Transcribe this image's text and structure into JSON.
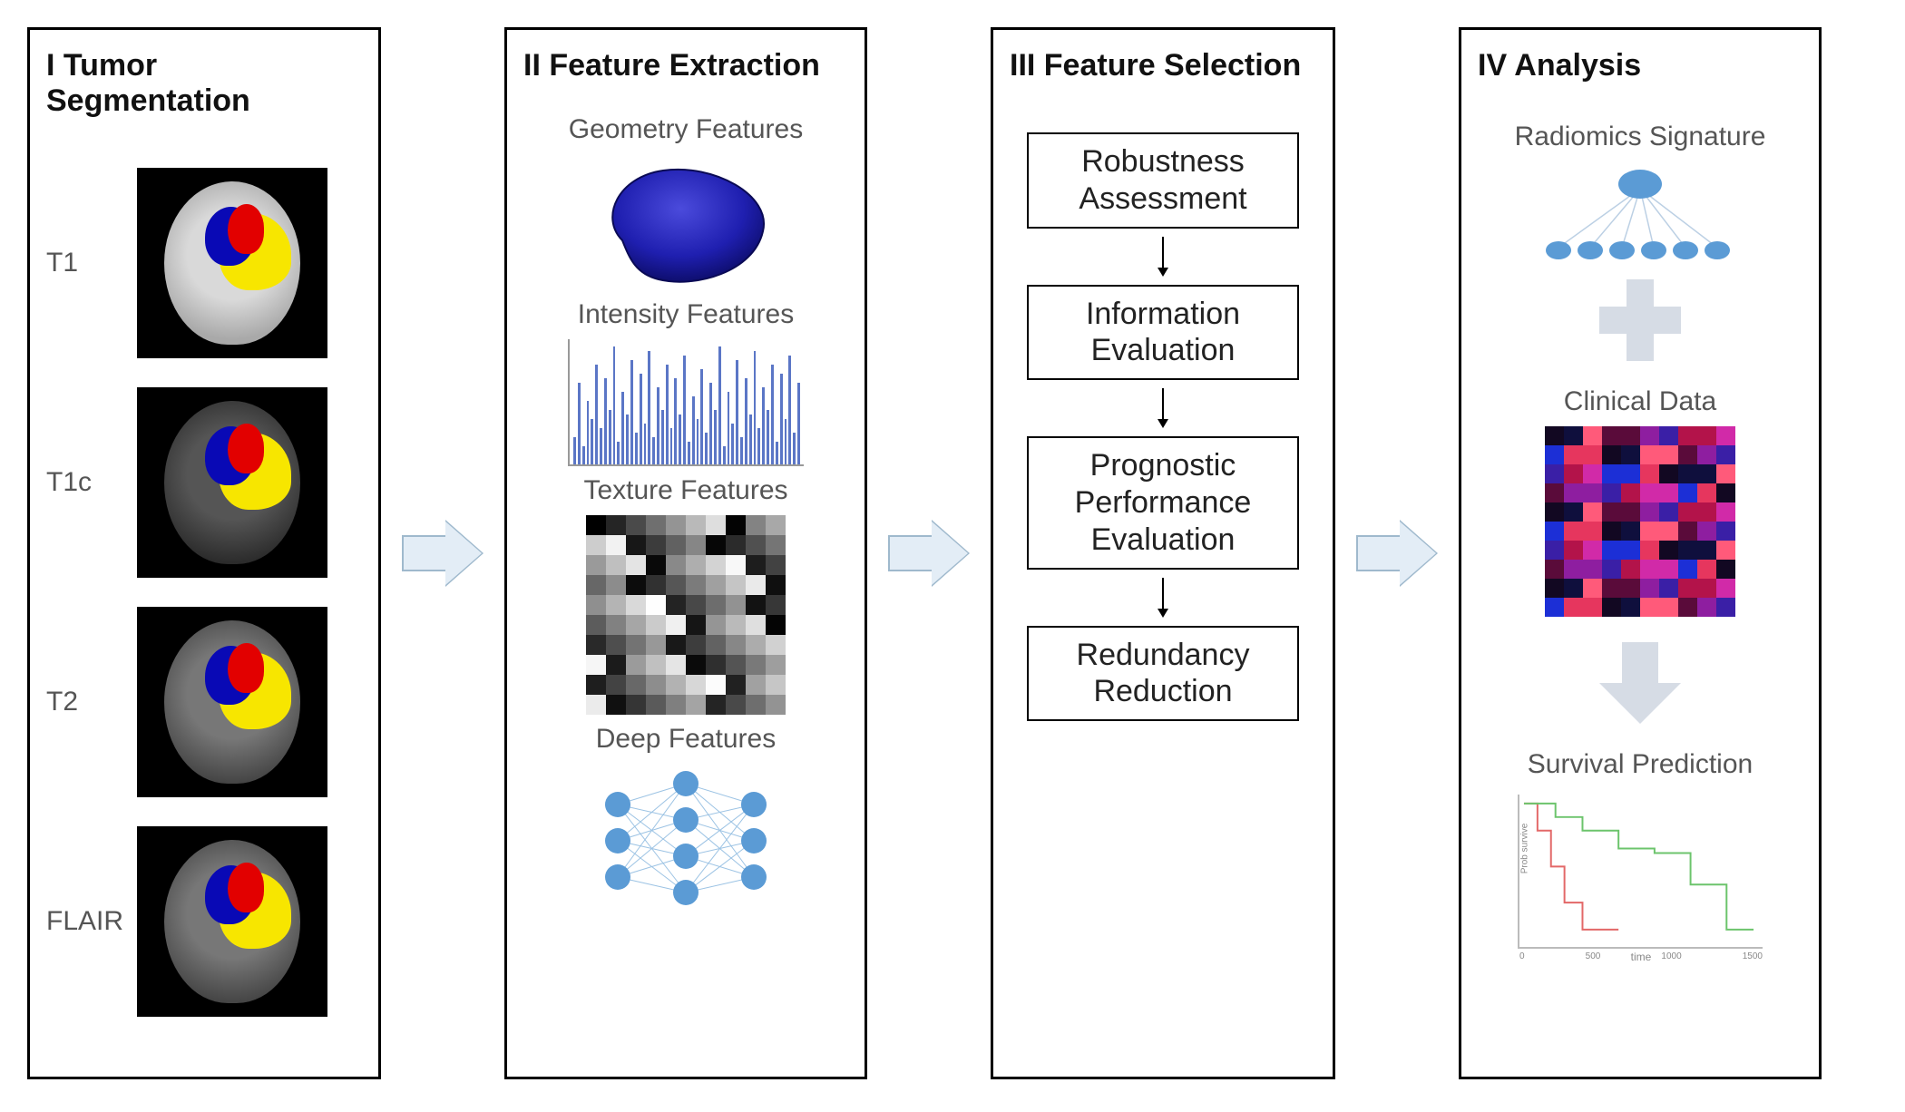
{
  "panel1": {
    "title": "I  Tumor Segmentation",
    "scans": [
      "T1",
      "T1c",
      "T2",
      "FLAIR"
    ]
  },
  "panel2": {
    "title": "II  Feature Extraction",
    "geometry": "Geometry Features",
    "intensity": "Intensity Features",
    "texture": "Texture Features",
    "deep": "Deep Features"
  },
  "panel3": {
    "title": "III Feature Selection",
    "steps": [
      "Robustness Assessment",
      "Information Evaluation",
      "Prognostic Performance Evaluation",
      "Redundancy Reduction"
    ]
  },
  "panel4": {
    "title": "IV  Analysis",
    "sig": "Radiomics Signature",
    "clin": "Clinical Data",
    "surv": "Survival Prediction",
    "surv_xlabel": "time",
    "surv_ylabel": "Prob survive",
    "surv_ticks": [
      "0",
      "500",
      "1000",
      "1500"
    ]
  },
  "colors": {
    "node": "#5b9bd5",
    "softgray": "#d6dce5"
  }
}
